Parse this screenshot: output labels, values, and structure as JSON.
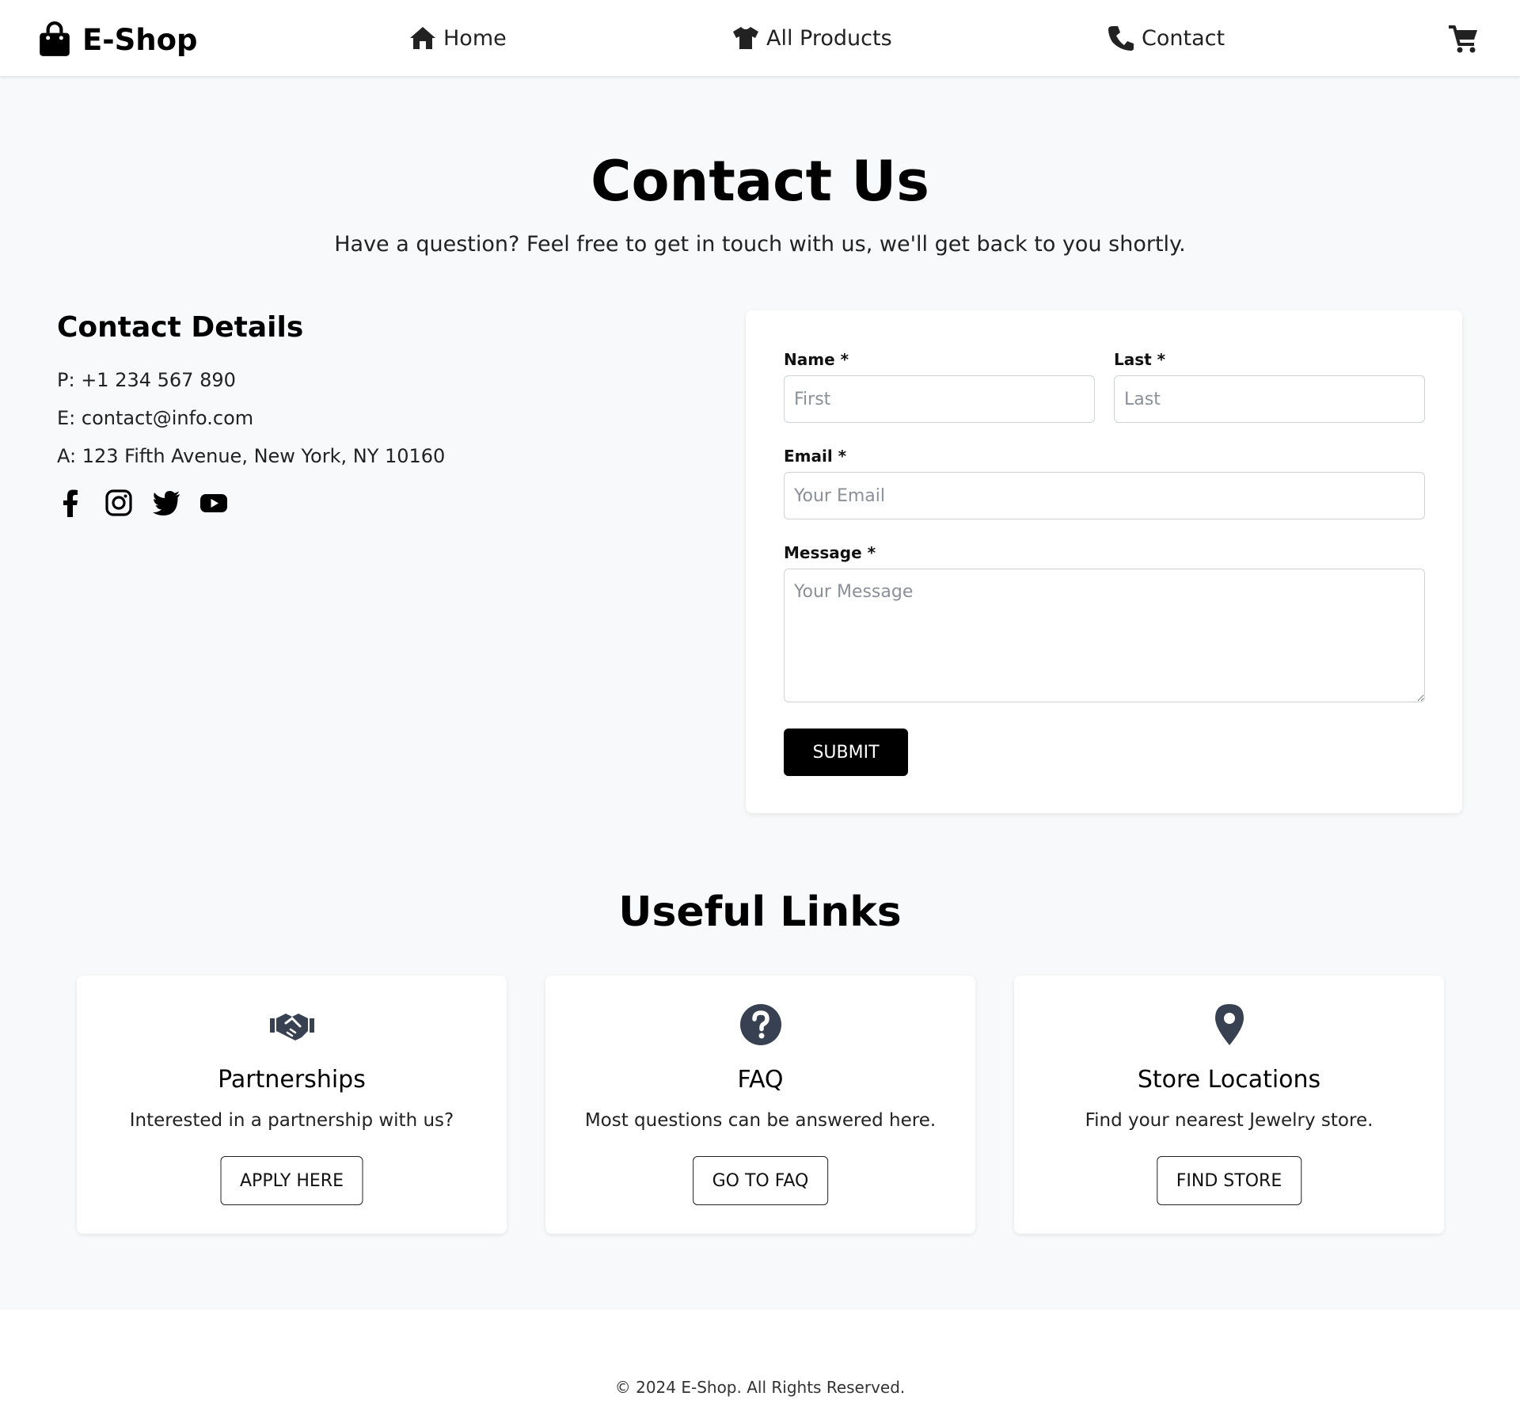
{
  "navbar": {
    "brand": "E-Shop",
    "brand_icon": "shopping-bag-icon",
    "links": [
      {
        "label": "Home",
        "icon": "home-icon"
      },
      {
        "label": "All Products",
        "icon": "tshirt-icon"
      },
      {
        "label": "Contact",
        "icon": "phone-icon"
      }
    ],
    "cart_icon": "cart-icon"
  },
  "hero": {
    "title": "Contact Us",
    "subtitle": "Have a question? Feel free to get in touch with us, we'll get back to you shortly."
  },
  "contact_details": {
    "heading": "Contact Details",
    "phone": "P: +1 234 567 890",
    "email": "E: contact@info.com",
    "address": "A: 123 Fifth Avenue, New York, NY 10160",
    "socials": [
      "facebook-icon",
      "instagram-icon",
      "twitter-icon",
      "youtube-icon"
    ]
  },
  "form": {
    "name_label": "Name *",
    "name_placeholder": "First",
    "last_label": "Last *",
    "last_placeholder": "Last",
    "email_label": "Email *",
    "email_placeholder": "Your Email",
    "message_label": "Message *",
    "message_placeholder": "Your Message",
    "submit_label": "SUBMIT"
  },
  "useful_links": {
    "heading": "Useful Links",
    "cards": [
      {
        "icon": "handshake-icon",
        "title": "Partnerships",
        "description": "Interested in a partnership with us?",
        "button": "APPLY HERE"
      },
      {
        "icon": "question-circle-icon",
        "title": "FAQ",
        "description": "Most questions can be answered here.",
        "button": "GO TO FAQ"
      },
      {
        "icon": "map-pin-icon",
        "title": "Store Locations",
        "description": "Find your nearest Jewelry store.",
        "button": "FIND STORE"
      }
    ]
  },
  "footer": {
    "text": "© 2024 E-Shop. All Rights Reserved."
  },
  "colors": {
    "page_background": "#f8f9fa",
    "card_background": "#ffffff",
    "primary_button": "#000000",
    "icon_slate": "#374151"
  }
}
